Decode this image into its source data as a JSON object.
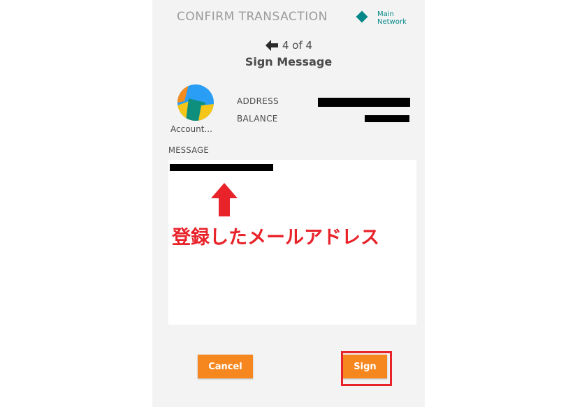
{
  "header": {
    "title": "CONFIRM TRANSACTION",
    "network": "Main\nNetwork",
    "network_color": "#038789"
  },
  "step": {
    "text": "4 of 4",
    "back_icon": "arrow-left-icon"
  },
  "subtitle": "Sign Message",
  "account": {
    "name": "Account...",
    "address_label": "ADDRESS",
    "balance_label": "BALANCE"
  },
  "message": {
    "label": "MESSAGE"
  },
  "annotation": {
    "text": "登録したメールアドレス",
    "color": "#e8232a",
    "arrow_icon": "arrow-up-icon"
  },
  "buttons": {
    "cancel": "Cancel",
    "sign": "Sign",
    "accent": "#f6871f"
  }
}
